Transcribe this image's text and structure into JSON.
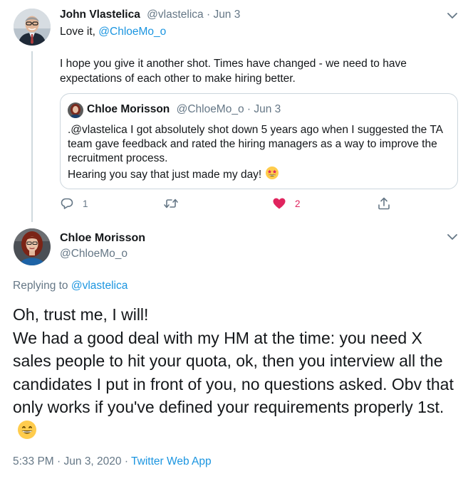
{
  "tweet1": {
    "author_name": "John Vlastelica",
    "author_handle": "@vlastelica",
    "separator": " · ",
    "date": "Jun 3",
    "line1_prefix": "Love it, ",
    "line1_mention": "@ChloeMo_o",
    "body": "I hope you give it another shot.  Times have changed - we need to have expectations of each other to make hiring better.",
    "quote": {
      "author_name": "Chloe Morisson",
      "author_handle": "@ChloeMo_o",
      "date": "Jun 3",
      "body_line1": ".@vlastelica I got absolutely shot down 5 years ago when I suggested the TA team gave feedback and rated the hiring managers as a way to improve the recruitment process.",
      "body_line2": "Hearing you say that just made my day!",
      "emoji": "star-struck-emoji"
    },
    "actions": {
      "reply_count": "1",
      "retweet_count": "",
      "like_count": "2",
      "share_count": ""
    },
    "colors": {
      "like": "#e0245e",
      "link": "#1b95e0"
    }
  },
  "tweet2": {
    "author_name": "Chloe Morisson",
    "author_handle": "@ChloeMo_o",
    "replying_prefix": "Replying to ",
    "replying_mention": "@vlastelica",
    "body": "Oh, trust me, I will!\nWe had a good deal with my HM at the time: you need X sales people to hit your quota, ok, then you interview all the candidates I put in front of you, no questions asked. Obv that only works if you've defined your requirements properly 1st.",
    "emoji": "grinning-emoji",
    "time": "5:33 PM",
    "date": "Jun 3, 2020",
    "meta_separator": " · ",
    "source": "Twitter Web App"
  }
}
